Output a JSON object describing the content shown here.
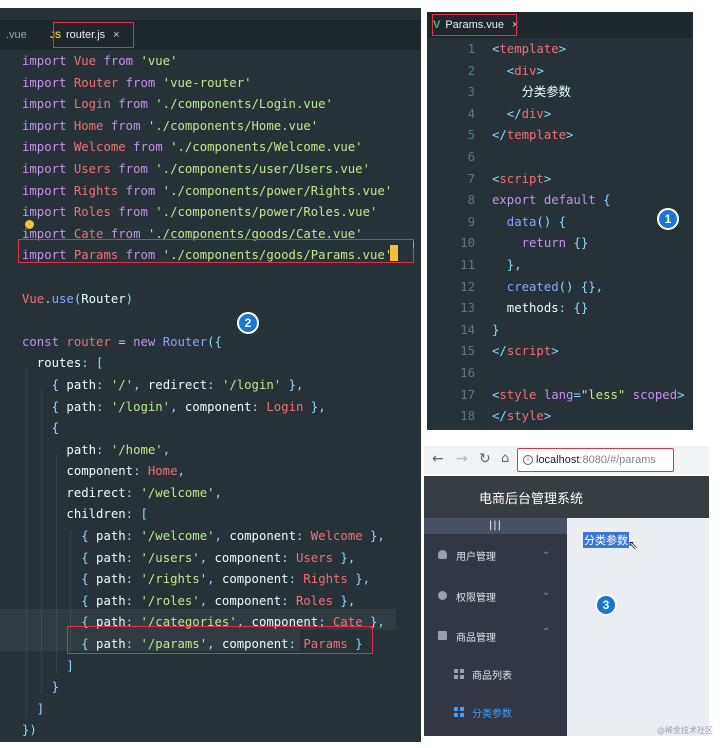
{
  "left_editor": {
    "prev_tab": ".vue",
    "tab": {
      "badge": "JS",
      "label": "router.js",
      "close": "×"
    },
    "code": [
      [
        [
          "k",
          "import "
        ],
        [
          "v",
          "Vue"
        ],
        [
          "k",
          " from "
        ],
        [
          "s",
          "'vue'"
        ]
      ],
      [
        [
          "k",
          "import "
        ],
        [
          "v",
          "Router"
        ],
        [
          "k",
          " from "
        ],
        [
          "s",
          "'vue-router'"
        ]
      ],
      [
        [
          "k",
          "import "
        ],
        [
          "v",
          "Login"
        ],
        [
          "k",
          " from "
        ],
        [
          "s",
          "'./components/Login.vue'"
        ]
      ],
      [
        [
          "k",
          "import "
        ],
        [
          "v",
          "Home"
        ],
        [
          "k",
          " from "
        ],
        [
          "s",
          "'./components/Home.vue'"
        ]
      ],
      [
        [
          "k",
          "import "
        ],
        [
          "v",
          "Welcome"
        ],
        [
          "k",
          " from "
        ],
        [
          "s",
          "'./components/Welcome.vue'"
        ]
      ],
      [
        [
          "k",
          "import "
        ],
        [
          "v",
          "Users"
        ],
        [
          "k",
          " from "
        ],
        [
          "s",
          "'./components/user/Users.vue'"
        ]
      ],
      [
        [
          "k",
          "import "
        ],
        [
          "v",
          "Rights"
        ],
        [
          "k",
          " from "
        ],
        [
          "s",
          "'./components/power/Rights.vue'"
        ]
      ],
      [
        [
          "k",
          "import "
        ],
        [
          "v",
          "Roles"
        ],
        [
          "k",
          " from "
        ],
        [
          "s",
          "'./components/power/Roles.vue'"
        ]
      ],
      [
        [
          "k",
          "import "
        ],
        [
          "v",
          "Cate"
        ],
        [
          "k",
          " from "
        ],
        [
          "s",
          "'./components/goods/Cate.vue'"
        ]
      ],
      [
        [
          "k",
          "import "
        ],
        [
          "v",
          "Params"
        ],
        [
          "k",
          " from "
        ],
        [
          "s",
          "'./components/goods/Params.vue'"
        ]
      ],
      [],
      [
        [
          "v",
          "Vue"
        ],
        [
          "p",
          "."
        ],
        [
          "f",
          "use"
        ],
        [
          "p",
          "("
        ],
        [
          "w",
          "Router"
        ],
        [
          "p",
          ")"
        ]
      ],
      [],
      [
        [
          "k",
          "const "
        ],
        [
          "v",
          "router"
        ],
        [
          "p",
          " = "
        ],
        [
          "k",
          "new "
        ],
        [
          "f",
          "Router"
        ],
        [
          "p",
          "({"
        ]
      ],
      [
        [
          "w",
          "  routes"
        ],
        [
          "p",
          ": ["
        ]
      ],
      [
        [
          "p",
          "    { "
        ],
        [
          "w",
          "path"
        ],
        [
          "p",
          ": "
        ],
        [
          "s",
          "'/'"
        ],
        [
          "p",
          ", "
        ],
        [
          "w",
          "redirect"
        ],
        [
          "p",
          ": "
        ],
        [
          "s",
          "'/login'"
        ],
        [
          "p",
          " },"
        ]
      ],
      [
        [
          "p",
          "    { "
        ],
        [
          "w",
          "path"
        ],
        [
          "p",
          ": "
        ],
        [
          "s",
          "'/login'"
        ],
        [
          "p",
          ", "
        ],
        [
          "w",
          "component"
        ],
        [
          "p",
          ": "
        ],
        [
          "v",
          "Login"
        ],
        [
          "p",
          " },"
        ]
      ],
      [
        [
          "p",
          "    {"
        ]
      ],
      [
        [
          "w",
          "      path"
        ],
        [
          "p",
          ": "
        ],
        [
          "s",
          "'/home'"
        ],
        [
          "p",
          ","
        ]
      ],
      [
        [
          "w",
          "      component"
        ],
        [
          "p",
          ": "
        ],
        [
          "v",
          "Home"
        ],
        [
          "p",
          ","
        ]
      ],
      [
        [
          "w",
          "      redirect"
        ],
        [
          "p",
          ": "
        ],
        [
          "s",
          "'/welcome'"
        ],
        [
          "p",
          ","
        ]
      ],
      [
        [
          "w",
          "      children"
        ],
        [
          "p",
          ": ["
        ]
      ],
      [
        [
          "p",
          "        { "
        ],
        [
          "w",
          "path"
        ],
        [
          "p",
          ": "
        ],
        [
          "s",
          "'/welcome'"
        ],
        [
          "p",
          ", "
        ],
        [
          "w",
          "component"
        ],
        [
          "p",
          ": "
        ],
        [
          "v",
          "Welcome"
        ],
        [
          "p",
          " },"
        ]
      ],
      [
        [
          "p",
          "        { "
        ],
        [
          "w",
          "path"
        ],
        [
          "p",
          ": "
        ],
        [
          "s",
          "'/users'"
        ],
        [
          "p",
          ", "
        ],
        [
          "w",
          "component"
        ],
        [
          "p",
          ": "
        ],
        [
          "v",
          "Users"
        ],
        [
          "p",
          " },"
        ]
      ],
      [
        [
          "p",
          "        { "
        ],
        [
          "w",
          "path"
        ],
        [
          "p",
          ": "
        ],
        [
          "s",
          "'/rights'"
        ],
        [
          "p",
          ", "
        ],
        [
          "w",
          "component"
        ],
        [
          "p",
          ": "
        ],
        [
          "v",
          "Rights"
        ],
        [
          "p",
          " },"
        ]
      ],
      [
        [
          "p",
          "        { "
        ],
        [
          "w",
          "path"
        ],
        [
          "p",
          ": "
        ],
        [
          "s",
          "'/roles'"
        ],
        [
          "p",
          ", "
        ],
        [
          "w",
          "component"
        ],
        [
          "p",
          ": "
        ],
        [
          "v",
          "Roles"
        ],
        [
          "p",
          " },"
        ]
      ],
      [
        [
          "p",
          "        { "
        ],
        [
          "w",
          "path"
        ],
        [
          "p",
          ": "
        ],
        [
          "s",
          "'/categories'"
        ],
        [
          "p",
          ", "
        ],
        [
          "w",
          "component"
        ],
        [
          "p",
          ": "
        ],
        [
          "v",
          "Cate"
        ],
        [
          "p",
          " },"
        ]
      ],
      [
        [
          "p",
          "        { "
        ],
        [
          "w",
          "path"
        ],
        [
          "p",
          ": "
        ],
        [
          "s",
          "'/params'"
        ],
        [
          "p",
          ", "
        ],
        [
          "w",
          "component"
        ],
        [
          "p",
          ": "
        ],
        [
          "v",
          "Params"
        ],
        [
          "p",
          " }"
        ]
      ],
      [
        [
          "p",
          "      ]"
        ]
      ],
      [
        [
          "p",
          "    }"
        ]
      ],
      [
        [
          "p",
          "  ]"
        ]
      ],
      [
        [
          "p",
          "})"
        ]
      ]
    ],
    "badge": "2"
  },
  "right_editor": {
    "tab": {
      "badge": "V",
      "label": "Params.vue",
      "close": "×"
    },
    "line_numbers": [
      "1",
      "2",
      "3",
      "4",
      "5",
      "6",
      "7",
      "8",
      "9",
      "10",
      "11",
      "12",
      "13",
      "14",
      "15",
      "16",
      "17",
      "18"
    ],
    "code": [
      [
        [
          "p",
          "<"
        ],
        [
          "v",
          "template"
        ],
        [
          "p",
          ">"
        ]
      ],
      [
        [
          "p",
          "  <"
        ],
        [
          "v",
          "div"
        ],
        [
          "p",
          ">"
        ]
      ],
      [
        [
          "w",
          "    分类参数"
        ]
      ],
      [
        [
          "p",
          "  </"
        ],
        [
          "v",
          "div"
        ],
        [
          "p",
          ">"
        ]
      ],
      [
        [
          "p",
          "</"
        ],
        [
          "v",
          "template"
        ],
        [
          "p",
          ">"
        ]
      ],
      [],
      [
        [
          "p",
          "<"
        ],
        [
          "v",
          "script"
        ],
        [
          "p",
          ">"
        ]
      ],
      [
        [
          "k",
          "export default "
        ],
        [
          "p",
          "{"
        ]
      ],
      [
        [
          "f",
          "  data"
        ],
        [
          "p",
          "() {"
        ]
      ],
      [
        [
          "k",
          "    return "
        ],
        [
          "p",
          "{}"
        ]
      ],
      [
        [
          "p",
          "  },"
        ]
      ],
      [
        [
          "f",
          "  created"
        ],
        [
          "p",
          "() {},"
        ]
      ],
      [
        [
          "w",
          "  methods"
        ],
        [
          "p",
          ": {}"
        ]
      ],
      [
        [
          "p",
          "}"
        ]
      ],
      [
        [
          "p",
          "</"
        ],
        [
          "v",
          "script"
        ],
        [
          "p",
          ">"
        ]
      ],
      [],
      [
        [
          "p",
          "<"
        ],
        [
          "v",
          "style "
        ],
        [
          "k",
          "lang"
        ],
        [
          "p",
          "="
        ],
        [
          "s",
          "\"less\""
        ],
        [
          "k",
          " scoped"
        ],
        [
          "p",
          ">"
        ]
      ],
      [
        [
          "p",
          "</"
        ],
        [
          "v",
          "style"
        ],
        [
          "p",
          ">"
        ]
      ]
    ],
    "badge": "1"
  },
  "browser": {
    "url_host": "localhost",
    "url_rest": ":8080/#/params",
    "app_title": "电商后台管理系统",
    "collapse_label": "|||",
    "menu": [
      {
        "label": "用户管理",
        "arrow": "⌄"
      },
      {
        "label": "权限管理",
        "arrow": "⌄"
      },
      {
        "label": "商品管理",
        "arrow": "⌃"
      }
    ],
    "submenu": [
      {
        "label": "商品列表"
      },
      {
        "label": "分类参数"
      }
    ],
    "content_text": "分类参数",
    "badge": "3",
    "colors": {
      "active": "#409eff",
      "sidebar": "#333744",
      "header": "#373d41"
    }
  },
  "watermark": "@稀金技术社区"
}
